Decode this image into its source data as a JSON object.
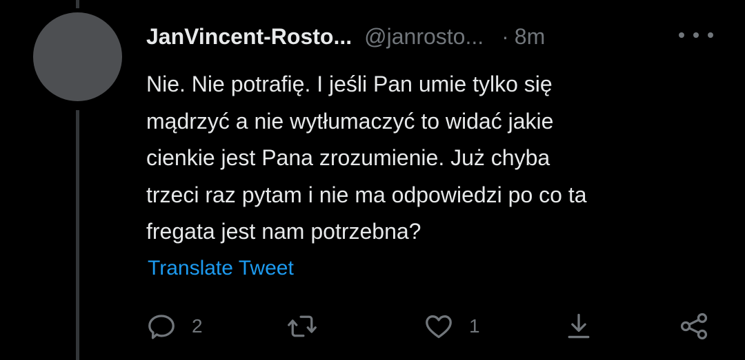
{
  "tweet": {
    "author": {
      "display_name": "JanVincent-Rosto...",
      "handle": "@janrosto...",
      "separator": "·",
      "time": "8m",
      "avatar_color": "#4d4f52"
    },
    "text": "Nie. Nie potrafię. I jeśli Pan umie tylko się\nmądrzyć a nie wytłumaczyć to widać jakie\ncienkie jest Pana zrozumienie. Już chyba\ntrzeci raz pytam i nie ma odpowiedzi po co ta\nfregata jest nam potrzebna?",
    "translate_label": "Translate Tweet",
    "actions": {
      "reply": {
        "icon": "reply-icon",
        "count": "2"
      },
      "retweet": {
        "icon": "retweet-icon"
      },
      "like": {
        "icon": "heart-icon",
        "count": "1"
      },
      "download": {
        "icon": "download-icon"
      },
      "share": {
        "icon": "share-icon"
      }
    }
  },
  "colors": {
    "background": "#000000",
    "text": "#e7e9ea",
    "muted": "#71767b",
    "link": "#1d9bf0",
    "thread_line": "#333639"
  }
}
